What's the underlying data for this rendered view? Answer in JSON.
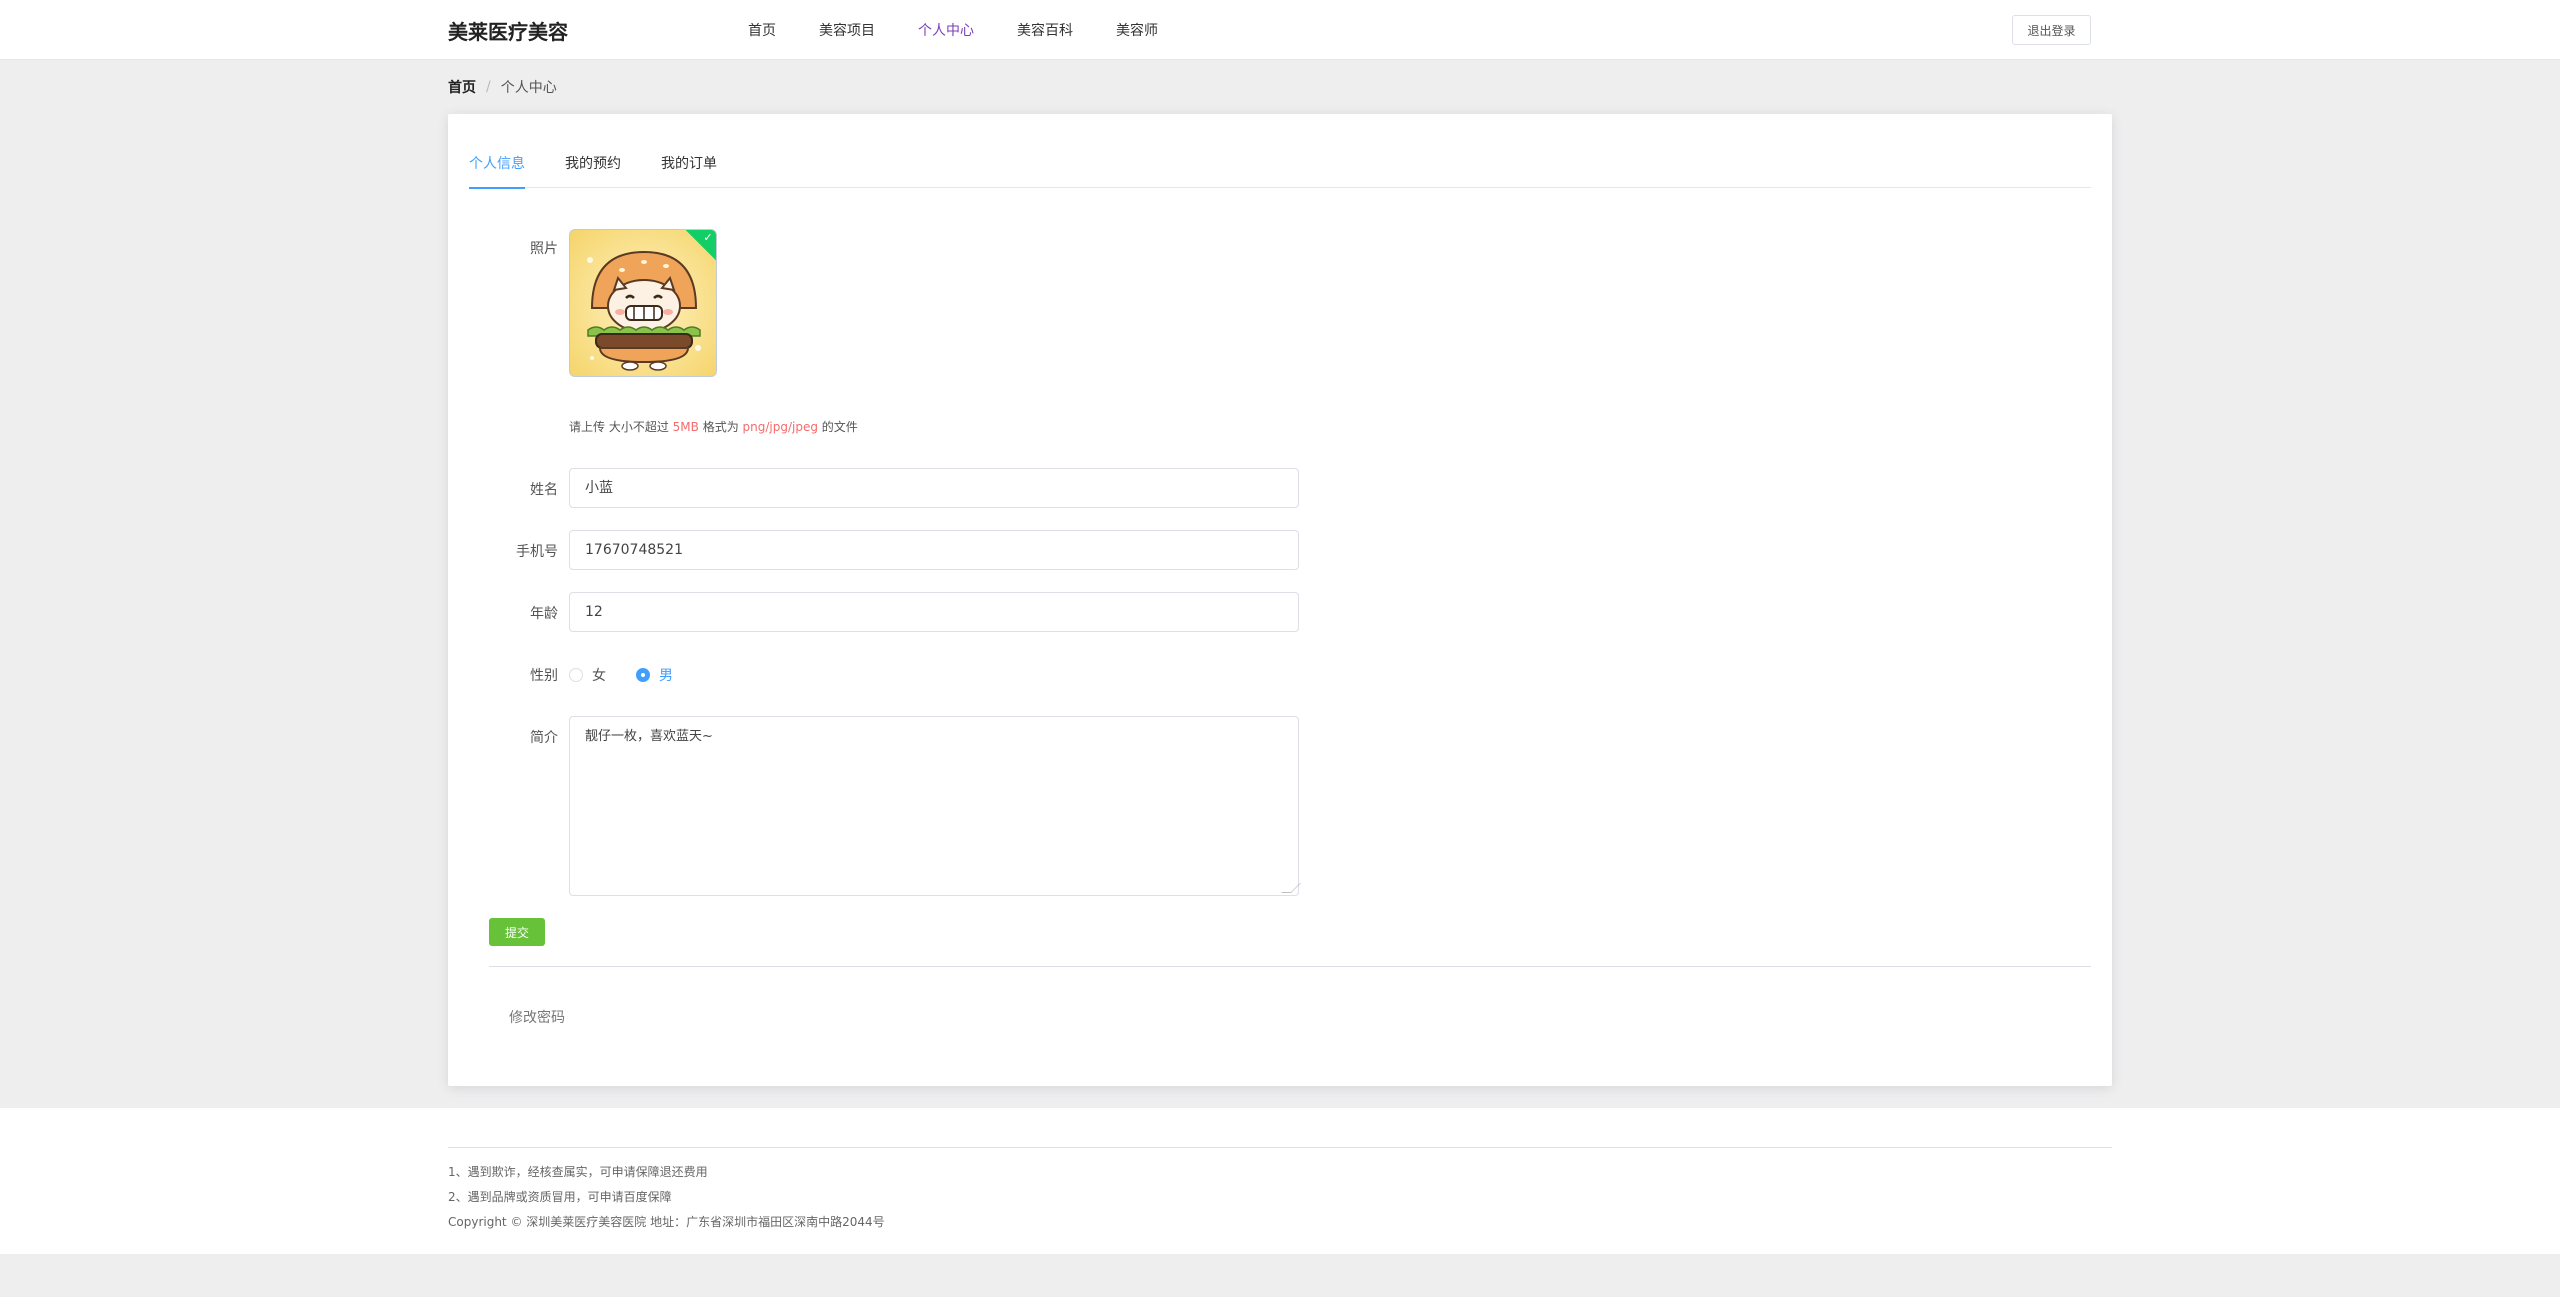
{
  "header": {
    "brand": "美莱医疗美容",
    "nav": [
      "首页",
      "美容项目",
      "个人中心",
      "美容百科",
      "美容师"
    ],
    "active_nav": "个人中心",
    "logout_label": "退出登录"
  },
  "breadcrumb": {
    "home": "首页",
    "separator": "/",
    "current": "个人中心"
  },
  "tabs": [
    "个人信息",
    "我的预约",
    "我的订单"
  ],
  "active_tab": "个人信息",
  "form": {
    "photo_label": "照片",
    "photo_icon": "burger-cat-avatar",
    "upload_tip": {
      "part1": "请上传 大小不超过 ",
      "size": "5MB",
      "part2": " 格式为 ",
      "formats": "png/jpg/jpeg",
      "part3": " 的文件"
    },
    "name_label": "姓名",
    "name_value": "小蓝",
    "phone_label": "手机号",
    "phone_value": "17670748521",
    "age_label": "年龄",
    "age_value": "12",
    "gender_label": "性别",
    "gender_options": [
      "女",
      "男"
    ],
    "gender_selected": "男",
    "intro_label": "简介",
    "intro_value": "靓仔一枚，喜欢蓝天~",
    "submit_label": "提交",
    "change_password_label": "修改密码"
  },
  "footer": {
    "line1": "1、遇到欺诈，经核查属实，可申请保障退还费用",
    "line2": "2、遇到品牌或资质冒用，可申请百度保障",
    "copyright": "Copyright © 深圳美莱医疗美容医院 地址：广东省深圳市福田区深南中路2044号"
  },
  "colors": {
    "accent_tab": "#409eff",
    "active_nav": "#7b3fb6",
    "submit": "#67c23a",
    "warning_text": "#f56c6c",
    "upload_success": "#13ce66"
  }
}
